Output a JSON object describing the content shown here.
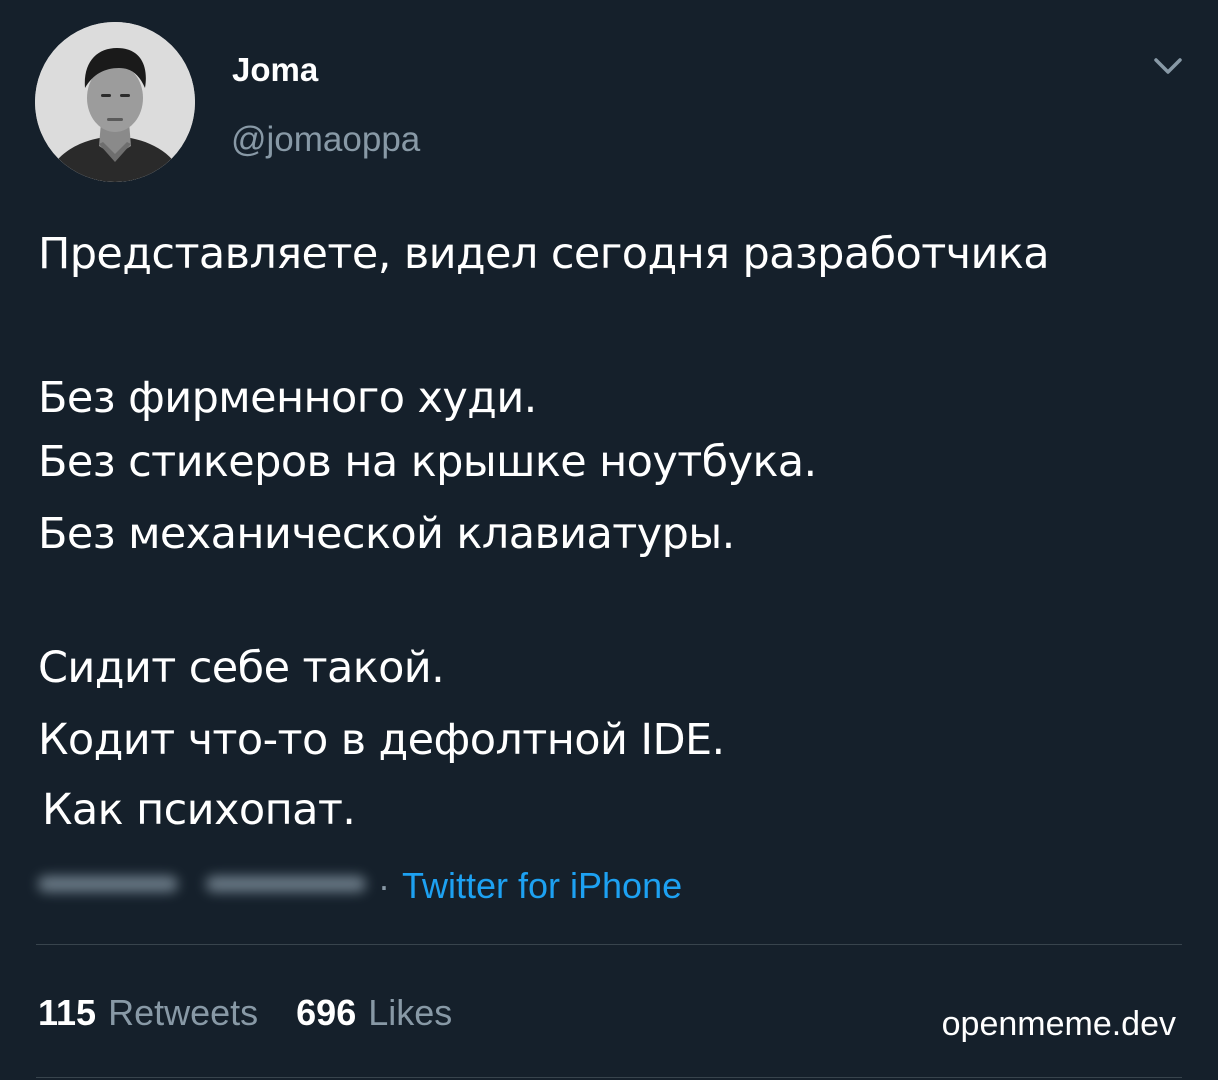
{
  "author": {
    "display_name": "Joma",
    "handle": "@jomaoppa"
  },
  "tweet": {
    "lines": [
      "Представляете, видел сегодня разработчика",
      "Без фирменного худи.",
      "Без стикеров на крышке ноутбука.",
      "Без механической клавиатуры.",
      "Сидит себе такой.",
      "Кодит что-то в дефолтной IDE.",
      "Как психопат."
    ]
  },
  "meta": {
    "separator": "·",
    "source": "Twitter for iPhone"
  },
  "stats": {
    "retweets_count": "115",
    "retweets_label": "Retweets",
    "likes_count": "696",
    "likes_label": "Likes"
  },
  "watermark": "openmeme.dev",
  "icons": {
    "more": "chevron-down-icon"
  },
  "colors": {
    "background": "#15202b",
    "primary_text": "#ffffff",
    "secondary_text": "#8899a6",
    "link": "#1da1f2",
    "divider": "#38444d"
  }
}
